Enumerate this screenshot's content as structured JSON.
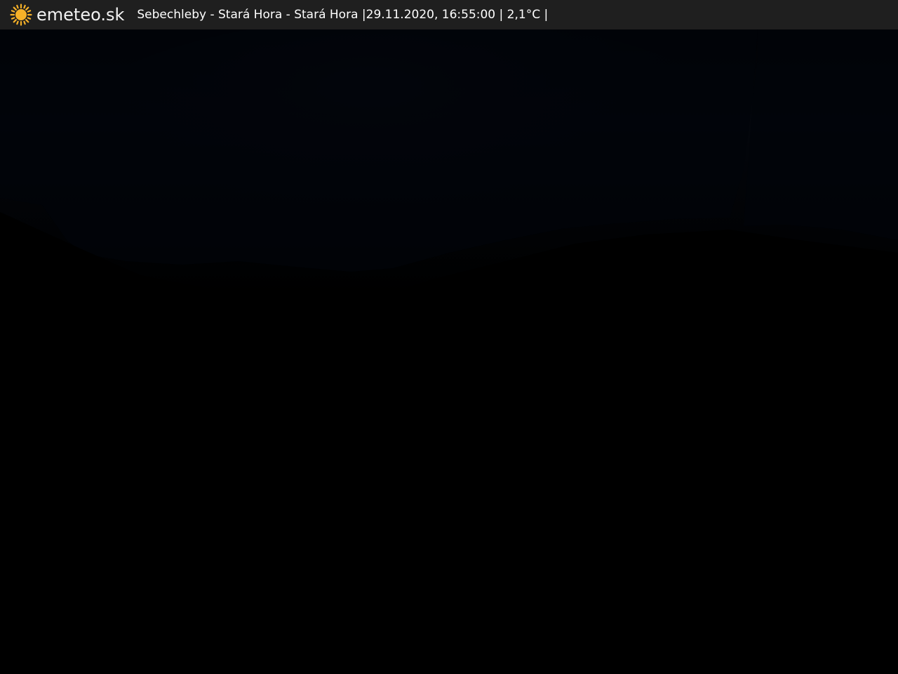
{
  "header": {
    "logo_text": "emeteo.sk",
    "logo_icon": "sun-icon",
    "location": "Sebechleby - Stará Hora - Stará Hora",
    "separator": "|",
    "datetime": "29.11.2020, 16:55:00",
    "temperature": "2,1°C"
  },
  "colors": {
    "bar_background": "#1f1f1f",
    "logo_sun": "#f6b128",
    "sky": "#020409",
    "ground": "#000000"
  }
}
